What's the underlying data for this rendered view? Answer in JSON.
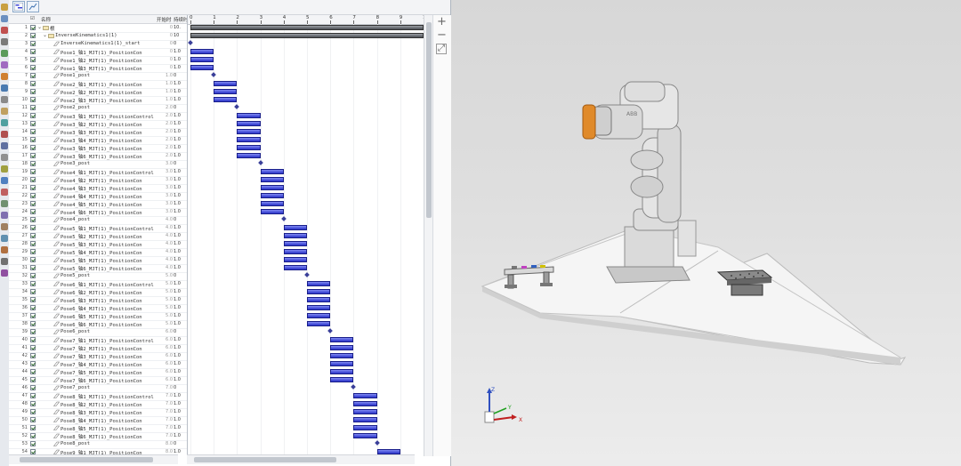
{
  "toolbar": {
    "buttons": [
      {
        "name": "gantt-view-icon"
      },
      {
        "name": "curve-view-icon"
      }
    ]
  },
  "table": {
    "columns": [
      "名称",
      "开始时",
      "持续时"
    ],
    "rows": [
      {
        "n": "1",
        "name": "根",
        "level": 0,
        "type": "root",
        "start": "0",
        "dur": "10.",
        "expanded": true
      },
      {
        "n": "2",
        "name": "InverseKinematics1(1)",
        "level": 1,
        "type": "group",
        "start": "0",
        "dur": "10",
        "expanded": true
      },
      {
        "n": "3",
        "name": "InverseKinematics1(1)_start",
        "level": 2,
        "type": "op",
        "start": "0",
        "dur": "0"
      },
      {
        "n": "4",
        "name": "Pose1_轴1_MJT(1)_PositionCon",
        "level": 2,
        "type": "op",
        "start": "0",
        "dur": "1.0"
      },
      {
        "n": "5",
        "name": "Pose1_轴2_MJT(1)_PositionCon",
        "level": 2,
        "type": "op",
        "start": "0",
        "dur": "1.0"
      },
      {
        "n": "6",
        "name": "Pose1_轴3_MJT(1)_PositionCon",
        "level": 2,
        "type": "op",
        "start": "0",
        "dur": "1.0"
      },
      {
        "n": "7",
        "name": "Pose1_post",
        "level": 2,
        "type": "op",
        "start": "1.0",
        "dur": "0"
      },
      {
        "n": "8",
        "name": "Pose2_轴1_MJT(1)_PositionCon",
        "level": 2,
        "type": "op",
        "start": "1.0",
        "dur": "1.0"
      },
      {
        "n": "9",
        "name": "Pose2_轴2_MJT(1)_PositionCon",
        "level": 2,
        "type": "op",
        "start": "1.0",
        "dur": "1.0"
      },
      {
        "n": "10",
        "name": "Pose2_轴3_MJT(1)_PositionCon",
        "level": 2,
        "type": "op",
        "start": "1.0",
        "dur": "1.0"
      },
      {
        "n": "11",
        "name": "Pose2_post",
        "level": 2,
        "type": "op",
        "start": "2.0",
        "dur": "0"
      },
      {
        "n": "12",
        "name": "Pose3_轴1_MJT(1)_PositionControl",
        "level": 2,
        "type": "op",
        "start": "2.0",
        "dur": "1.0"
      },
      {
        "n": "13",
        "name": "Pose3_轴2_MJT(1)_PositionCon",
        "level": 2,
        "type": "op",
        "start": "2.0",
        "dur": "1.0"
      },
      {
        "n": "14",
        "name": "Pose3_轴3_MJT(1)_PositionCon",
        "level": 2,
        "type": "op",
        "start": "2.0",
        "dur": "1.0"
      },
      {
        "n": "15",
        "name": "Pose3_轴4_MJT(1)_PositionCon",
        "level": 2,
        "type": "op",
        "start": "2.0",
        "dur": "1.0"
      },
      {
        "n": "16",
        "name": "Pose3_轴5_MJT(1)_PositionCon",
        "level": 2,
        "type": "op",
        "start": "2.0",
        "dur": "1.0"
      },
      {
        "n": "17",
        "name": "Pose3_轴6_MJT(1)_PositionCon",
        "level": 2,
        "type": "op",
        "start": "2.0",
        "dur": "1.0"
      },
      {
        "n": "18",
        "name": "Pose3_post",
        "level": 2,
        "type": "op",
        "start": "3.0",
        "dur": "0"
      },
      {
        "n": "19",
        "name": "Pose4_轴1_MJT(1)_PositionControl",
        "level": 2,
        "type": "op",
        "start": "3.0",
        "dur": "1.0"
      },
      {
        "n": "20",
        "name": "Pose4_轴2_MJT(1)_PositionCon",
        "level": 2,
        "type": "op",
        "start": "3.0",
        "dur": "1.0"
      },
      {
        "n": "21",
        "name": "Pose4_轴3_MJT(1)_PositionCon",
        "level": 2,
        "type": "op",
        "start": "3.0",
        "dur": "1.0"
      },
      {
        "n": "22",
        "name": "Pose4_轴4_MJT(1)_PositionCon",
        "level": 2,
        "type": "op",
        "start": "3.0",
        "dur": "1.0"
      },
      {
        "n": "23",
        "name": "Pose4_轴5_MJT(1)_PositionCon",
        "level": 2,
        "type": "op",
        "start": "3.0",
        "dur": "1.0"
      },
      {
        "n": "24",
        "name": "Pose4_轴6_MJT(1)_PositionCon",
        "level": 2,
        "type": "op",
        "start": "3.0",
        "dur": "1.0"
      },
      {
        "n": "25",
        "name": "Pose4_post",
        "level": 2,
        "type": "op",
        "start": "4.0",
        "dur": "0"
      },
      {
        "n": "26",
        "name": "Pose5_轴1_MJT(1)_PositionControl",
        "level": 2,
        "type": "op",
        "start": "4.0",
        "dur": "1.0"
      },
      {
        "n": "27",
        "name": "Pose5_轴2_MJT(1)_PositionCon",
        "level": 2,
        "type": "op",
        "start": "4.0",
        "dur": "1.0"
      },
      {
        "n": "28",
        "name": "Pose5_轴3_MJT(1)_PositionCon",
        "level": 2,
        "type": "op",
        "start": "4.0",
        "dur": "1.0"
      },
      {
        "n": "29",
        "name": "Pose5_轴4_MJT(1)_PositionCon",
        "level": 2,
        "type": "op",
        "start": "4.0",
        "dur": "1.0"
      },
      {
        "n": "30",
        "name": "Pose5_轴5_MJT(1)_PositionCon",
        "level": 2,
        "type": "op",
        "start": "4.0",
        "dur": "1.0"
      },
      {
        "n": "31",
        "name": "Pose5_轴6_MJT(1)_PositionCon",
        "level": 2,
        "type": "op",
        "start": "4.0",
        "dur": "1.0"
      },
      {
        "n": "32",
        "name": "Pose5_post",
        "level": 2,
        "type": "op",
        "start": "5.0",
        "dur": "0"
      },
      {
        "n": "33",
        "name": "Pose6_轴1_MJT(1)_PositionControl",
        "level": 2,
        "type": "op",
        "start": "5.0",
        "dur": "1.0"
      },
      {
        "n": "34",
        "name": "Pose6_轴2_MJT(1)_PositionCon",
        "level": 2,
        "type": "op",
        "start": "5.0",
        "dur": "1.0"
      },
      {
        "n": "35",
        "name": "Pose6_轴3_MJT(1)_PositionCon",
        "level": 2,
        "type": "op",
        "start": "5.0",
        "dur": "1.0"
      },
      {
        "n": "36",
        "name": "Pose6_轴4_MJT(1)_PositionCon",
        "level": 2,
        "type": "op",
        "start": "5.0",
        "dur": "1.0"
      },
      {
        "n": "37",
        "name": "Pose6_轴5_MJT(1)_PositionCon",
        "level": 2,
        "type": "op",
        "start": "5.0",
        "dur": "1.0"
      },
      {
        "n": "38",
        "name": "Pose6_轴6_MJT(1)_PositionCon",
        "level": 2,
        "type": "op",
        "start": "5.0",
        "dur": "1.0"
      },
      {
        "n": "39",
        "name": "Pose6_post",
        "level": 2,
        "type": "op",
        "start": "6.0",
        "dur": "0"
      },
      {
        "n": "40",
        "name": "Pose7_轴1_MJT(1)_PositionControl",
        "level": 2,
        "type": "op",
        "start": "6.0",
        "dur": "1.0"
      },
      {
        "n": "41",
        "name": "Pose7_轴2_MJT(1)_PositionCon",
        "level": 2,
        "type": "op",
        "start": "6.0",
        "dur": "1.0"
      },
      {
        "n": "42",
        "name": "Pose7_轴3_MJT(1)_PositionCon",
        "level": 2,
        "type": "op",
        "start": "6.0",
        "dur": "1.0"
      },
      {
        "n": "43",
        "name": "Pose7_轴4_MJT(1)_PositionCon",
        "level": 2,
        "type": "op",
        "start": "6.0",
        "dur": "1.0"
      },
      {
        "n": "44",
        "name": "Pose7_轴5_MJT(1)_PositionCon",
        "level": 2,
        "type": "op",
        "start": "6.0",
        "dur": "1.0"
      },
      {
        "n": "45",
        "name": "Pose7_轴6_MJT(1)_PositionCon",
        "level": 2,
        "type": "op",
        "start": "6.0",
        "dur": "1.0"
      },
      {
        "n": "46",
        "name": "Pose7_post",
        "level": 2,
        "type": "op",
        "start": "7.0",
        "dur": "0"
      },
      {
        "n": "47",
        "name": "Pose8_轴1_MJT(1)_PositionControl",
        "level": 2,
        "type": "op",
        "start": "7.0",
        "dur": "1.0"
      },
      {
        "n": "48",
        "name": "Pose8_轴2_MJT(1)_PositionCon",
        "level": 2,
        "type": "op",
        "start": "7.0",
        "dur": "1.0"
      },
      {
        "n": "49",
        "name": "Pose8_轴3_MJT(1)_PositionCon",
        "level": 2,
        "type": "op",
        "start": "7.0",
        "dur": "1.0"
      },
      {
        "n": "50",
        "name": "Pose8_轴4_MJT(1)_PositionCon",
        "level": 2,
        "type": "op",
        "start": "7.0",
        "dur": "1.0"
      },
      {
        "n": "51",
        "name": "Pose8_轴5_MJT(1)_PositionCon",
        "level": 2,
        "type": "op",
        "start": "7.0",
        "dur": "1.0"
      },
      {
        "n": "52",
        "name": "Pose8_轴6_MJT(1)_PositionCon",
        "level": 2,
        "type": "op",
        "start": "7.0",
        "dur": "1.0"
      },
      {
        "n": "53",
        "name": "Pose8_post",
        "level": 2,
        "type": "op",
        "start": "8.0",
        "dur": "0"
      },
      {
        "n": "54",
        "name": "Pose9_轴1_MJT(1)_PositionCon",
        "level": 2,
        "type": "op",
        "start": "8.0",
        "dur": "1.0"
      }
    ]
  },
  "gantt": {
    "ticks": [
      "0",
      "1",
      "2",
      "3",
      "4",
      "5",
      "6",
      "7",
      "8",
      "9",
      "10"
    ],
    "time_max": 10,
    "bar_color": "#3a42d6",
    "summary_color": "#6b6f74"
  },
  "right_tools": [
    {
      "name": "zoom-in-icon",
      "glyph": "+"
    },
    {
      "name": "zoom-out-icon",
      "glyph": "−"
    },
    {
      "name": "fit-view-icon",
      "glyph": "⤢"
    }
  ],
  "viewport": {
    "axis_labels": {
      "z": "Z",
      "x": "X",
      "y": "Y"
    },
    "robot_accent": "#e08a2a",
    "floor_color": "#f4f4f4"
  }
}
